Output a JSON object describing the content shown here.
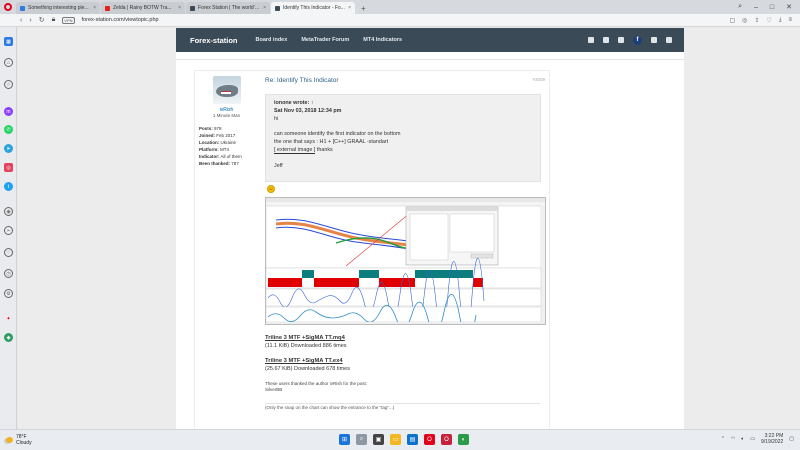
{
  "browser": {
    "tabs": [
      {
        "title": "Something interesting ple...",
        "color": "#2c7be5",
        "active": false
      },
      {
        "title": "Zelda | Rainy BOTW Tra...",
        "color": "#e62117",
        "active": false
      },
      {
        "title": "Forex Station | The world's...",
        "color": "#3a4a57",
        "active": false
      },
      {
        "title": "Identify This Indicator - Fo...",
        "color": "#3a4a57",
        "active": true
      }
    ],
    "vpn_label": "VPN",
    "url": "forex-station.com/viewtopic.php"
  },
  "site": {
    "brand": "Forex-station",
    "nav": [
      "Board index",
      "MetaTrader Forum",
      "MT4 Indicators"
    ],
    "facebook_letter": "f"
  },
  "profile": {
    "username": "ivRish",
    "rank": "1 Minute Man",
    "fields": [
      {
        "label": "Posts:",
        "value": "978"
      },
      {
        "label": "Joined:",
        "value": "Feb 2017"
      },
      {
        "label": "Location:",
        "value": "Ukraine"
      },
      {
        "label": "Platform:",
        "value": "MT4"
      },
      {
        "label": "Indicator:",
        "value": "All of them"
      },
      {
        "label": "Been thanked:",
        "value": "787"
      }
    ]
  },
  "post": {
    "title": "Re: Identify This Indicator",
    "number": "#3009",
    "quote": {
      "author": "ionone wrote: ↑",
      "date": "Sat Nov 03, 2018 12:34 pm",
      "line1": "hi",
      "line2": "can someone identify the first indicator on the bottom",
      "line3": "the one that says : H1 + [C++] GRAAL -standart",
      "external": "[ external image ]",
      "after_external": " thanks",
      "signoff": "Jeff"
    },
    "attachments": [
      {
        "name": "Triline 3 MTF +SigMA TT.mq4",
        "meta": "(11.1 KiB) Downloaded 886 times"
      },
      {
        "name": "Triline 3 MTF +SigMA TT.ex4",
        "meta": "(25.67 KiB) Downloaded 678 times"
      }
    ],
    "thanks_line1": "These users thanked the author ivRish for the post:",
    "thanks_line2": "SilverBB",
    "note": "(Only the snap on the chart can show the entrance to the \"tag\"...)"
  },
  "taskbar": {
    "temp": "78°F",
    "condition": "Cloudy",
    "time": "3:22 PM",
    "date": "9/19/2022"
  }
}
